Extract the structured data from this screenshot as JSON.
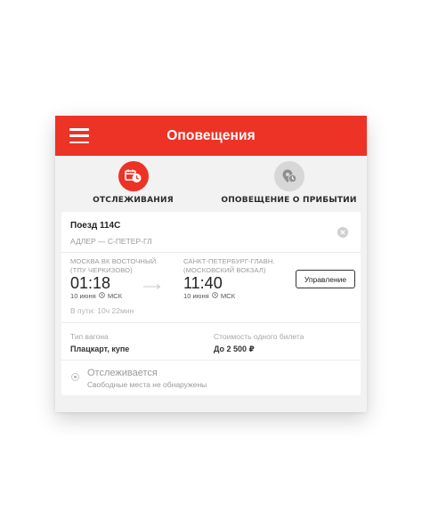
{
  "appbar": {
    "title": "Оповещения"
  },
  "tabs": [
    {
      "label": "ОТСЛЕЖИВАНИЯ",
      "icon": "calendar-clock-icon",
      "active": true
    },
    {
      "label": "ОПОВЕЩЕНИЕ О ПРИБЫТИИ",
      "icon": "location-clock-icon",
      "active": false
    }
  ],
  "card": {
    "train": "Поезд 114С",
    "route": "АДЛЕР — С-ПЕТЕР-ГЛ",
    "departure": {
      "station_line1": "МОСКВА ВК ВОСТОЧНЫЙ",
      "station_line2": "(ТПУ ЧЕРКИЗОВО)",
      "time": "01:18",
      "date": "10 июня",
      "tz": "МСК"
    },
    "arrival": {
      "station_line1": "САНКТ-ПЕТЕРБУРГ-ГЛАВН.",
      "station_line2": "(МОСКОВСКИЙ ВОКЗАЛ)",
      "time": "11:40",
      "date": "10 июня",
      "tz": "МСК"
    },
    "manage_label": "Управление",
    "travel_time": "В пути: 10ч 22мин",
    "car_type_label": "Тип вагона",
    "car_type_value": "Плацкарт, купе",
    "price_label": "Стоимость одного билета",
    "price_value": "До 2 500 ₽",
    "status_title": "Отслеживается",
    "status_sub": "Свободные места не обнаружены"
  },
  "colors": {
    "accent": "#ec3326",
    "background": "#f2f2f2"
  }
}
